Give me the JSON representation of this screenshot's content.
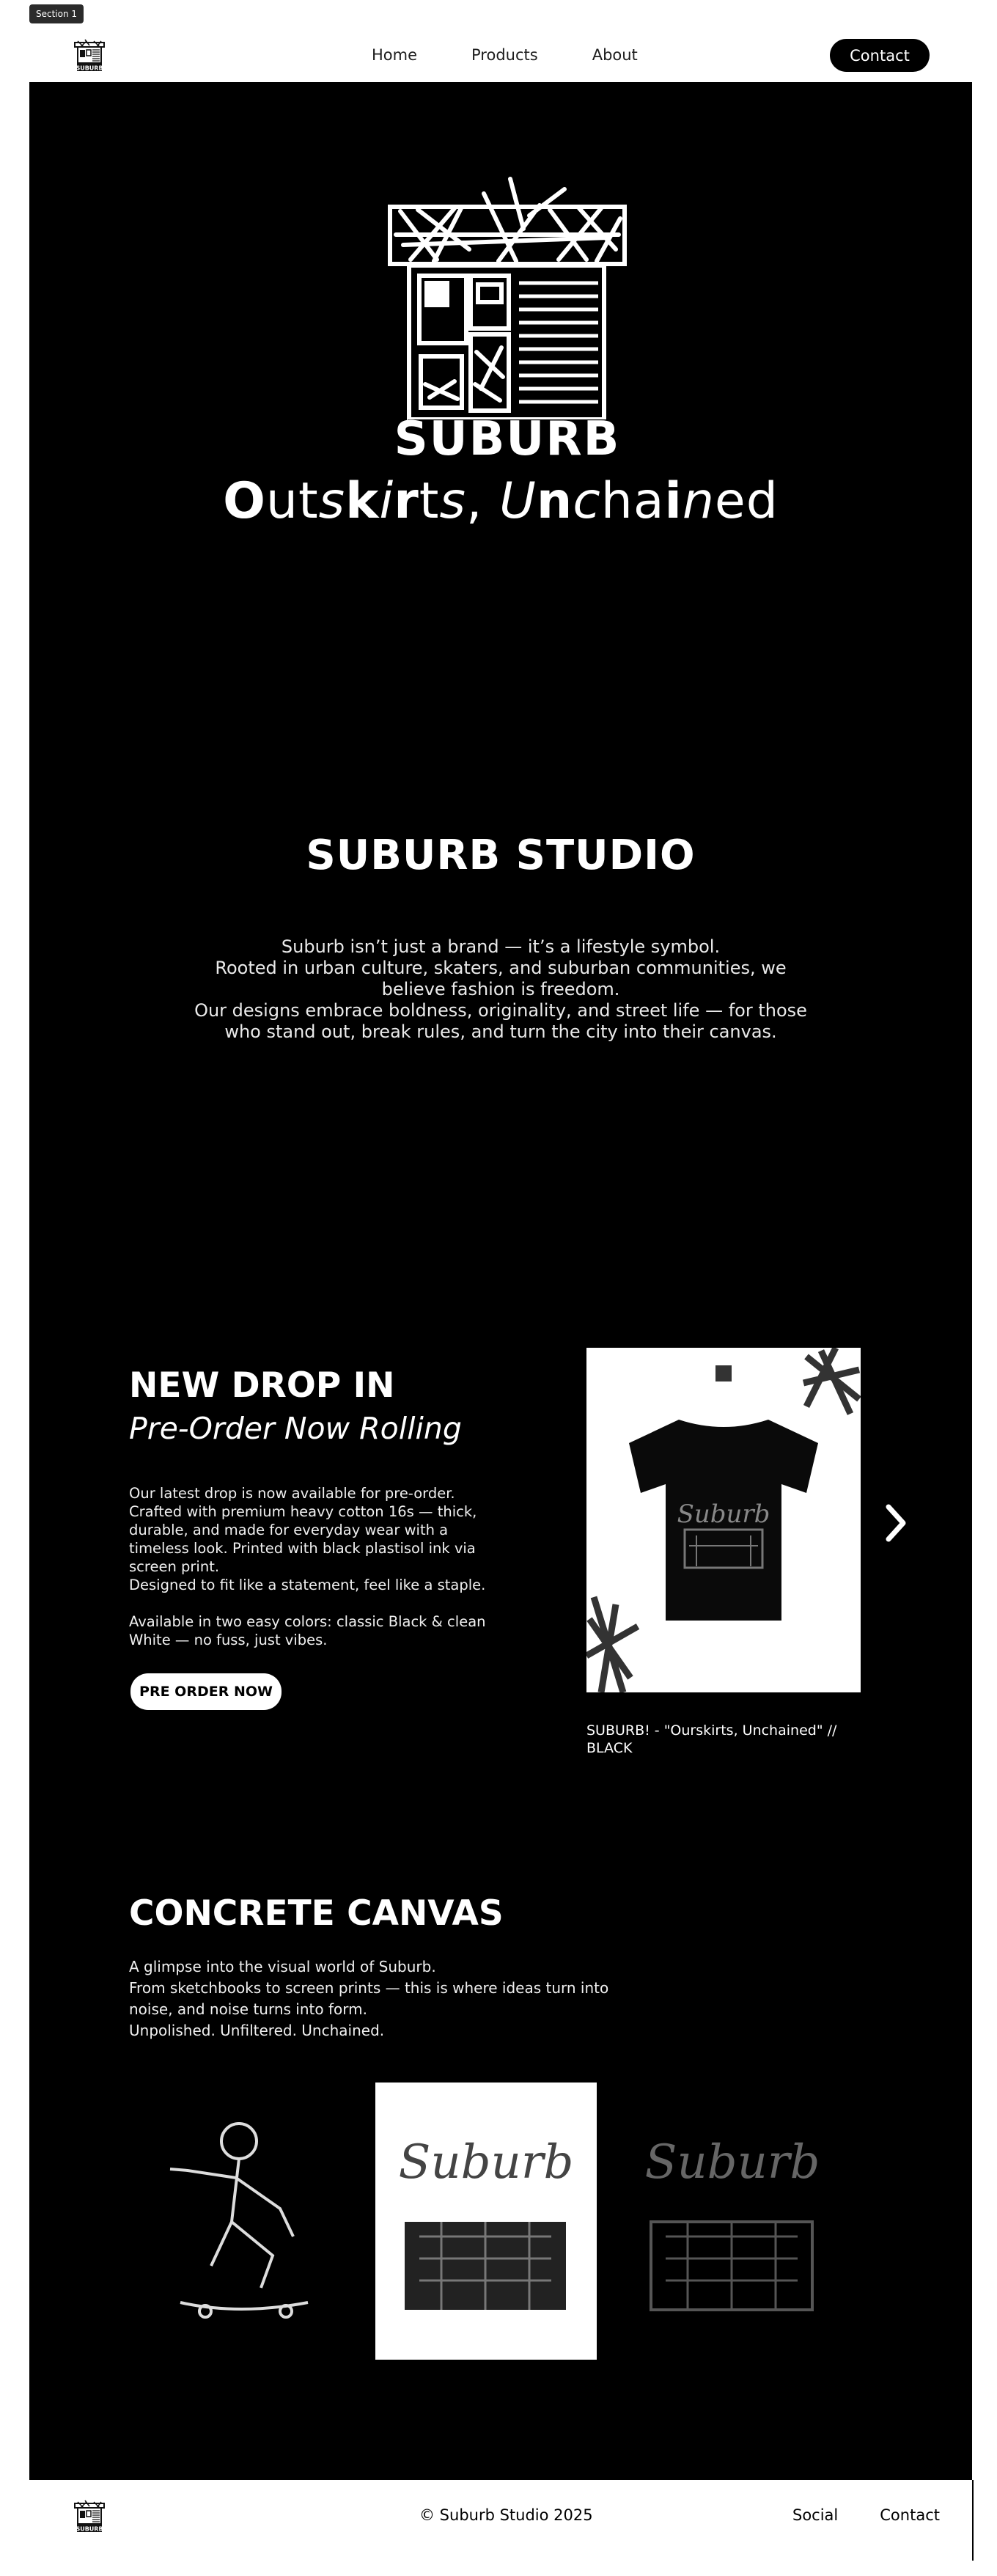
{
  "section_tag": "Section 1",
  "nav": {
    "home": "Home",
    "products": "Products",
    "about": "About",
    "contact": "Contact"
  },
  "brand": {
    "logo_text": "SUBURB"
  },
  "hero": {
    "tagline_parts": [
      "O",
      "ut",
      "s",
      "k",
      "i",
      "r",
      "t",
      "s",
      ", ",
      "U",
      "n",
      "c",
      "ha",
      "i",
      "n",
      "ed"
    ]
  },
  "studio": {
    "title": "SUBURB STUDIO",
    "lines": [
      "Suburb isn’t just a brand — it’s a lifestyle symbol.",
      "Rooted in urban culture, skaters, and suburban communities, we",
      "believe fashion is freedom.",
      "Our designs embrace boldness, originality, and street life — for those",
      "who stand out, break rules, and turn the city into their canvas."
    ]
  },
  "drop": {
    "title": "NEW DROP IN",
    "subtitle": "Pre-Order Now Rolling",
    "para1": "Our latest drop is now available for pre-order. Crafted with premium heavy cotton 16s — thick, durable, and made for everyday wear with a timeless look. Printed with black plastisol ink via screen print.",
    "para2": "Designed to fit like a statement, feel like a staple.",
    "para3": "Available in two easy colors: classic Black & clean White — no fuss, just vibes.",
    "button": "PRE ORDER NOW",
    "product_name": "SUBURB! - \"Ourskirts, Unchained\" // BLACK",
    "shirt_print_text": "Suburb"
  },
  "canvas": {
    "title": "CONCRETE CANVAS",
    "lines": [
      "A glimpse into the visual world of Suburb.",
      "From sketchbooks to screen prints — this is where ideas turn into noise, and noise turns into form.",
      "Unpolished. Unfiltered. Unchained."
    ],
    "art_text": "Suburb"
  },
  "footer": {
    "copyright": "© Suburb Studio 2025",
    "social": "Social",
    "contact": "Contact"
  },
  "colors": {
    "background": "#000000",
    "page": "#ffffff",
    "accent": "#ffffff"
  },
  "icons": [
    "house-logo-icon",
    "chevron-right-icon"
  ]
}
